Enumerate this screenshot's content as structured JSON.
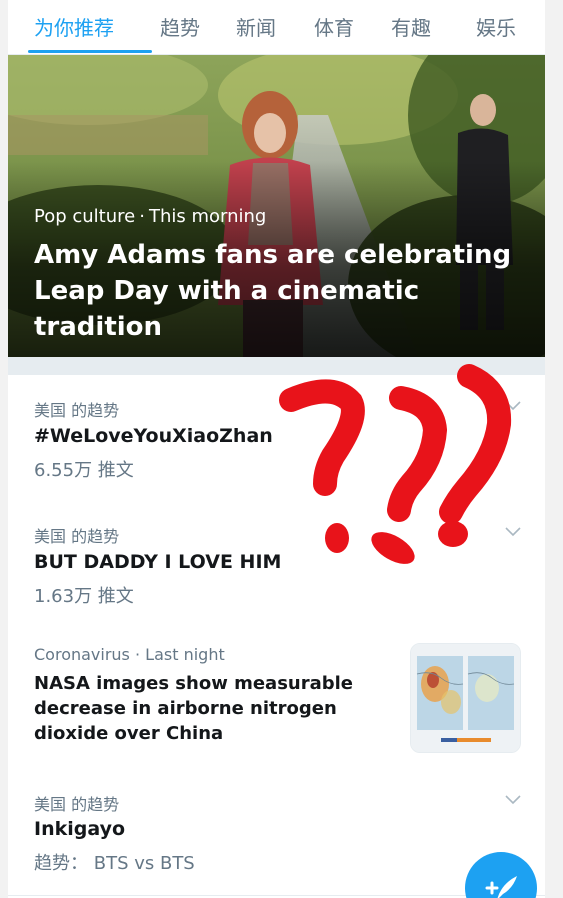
{
  "tabs": [
    {
      "label": "为你推荐",
      "active": true
    },
    {
      "label": "趋势",
      "active": false
    },
    {
      "label": "新闻",
      "active": false
    },
    {
      "label": "体育",
      "active": false
    },
    {
      "label": "有趣",
      "active": false
    },
    {
      "label": "娱乐",
      "active": false
    }
  ],
  "hero": {
    "category": "Pop culture",
    "separator": "·",
    "time": "This morning",
    "title": "Amy Adams fans are celebrating Leap Day with a cinematic tradition"
  },
  "trends": [
    {
      "context": "美国 的趋势",
      "title": "#WeLoveYouXiaoZhan",
      "meta": "6.55万 推文"
    },
    {
      "context": "美国 的趋势",
      "title": "BUT DADDY I LOVE HIM",
      "meta": "1.63万 推文"
    }
  ],
  "news": {
    "category": "Coronavirus",
    "separator": "·",
    "time": "Last night",
    "title": "NASA images show measurable decrease in airborne nitrogen dioxide over China"
  },
  "trend3": {
    "context": "美国 的趋势",
    "title": "Inkigayo",
    "meta": "趋势： BTS vs BTS"
  },
  "colors": {
    "accent": "#1da1f2",
    "doodle": "#e8131a"
  },
  "icons": {
    "chevron": "chevron-down-icon",
    "compose": "compose-tweet-icon"
  }
}
